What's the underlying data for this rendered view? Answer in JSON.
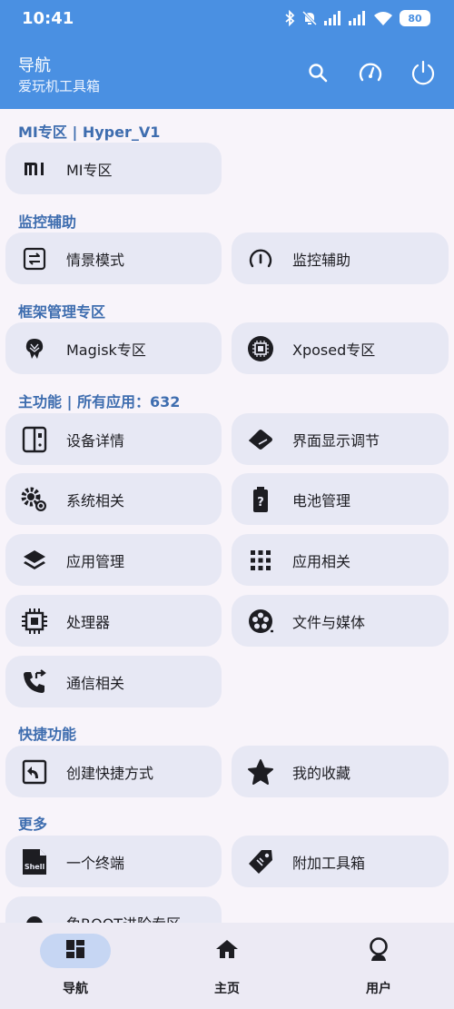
{
  "status_bar": {
    "time": "10:41",
    "battery": "80",
    "icons": [
      "bluetooth-icon",
      "mute-icon",
      "signal-icon",
      "signal-icon",
      "wifi-icon"
    ]
  },
  "app_bar": {
    "title": "导航",
    "subtitle": "爱玩机工具箱",
    "actions": [
      "search-icon",
      "speedometer-icon",
      "power-icon"
    ]
  },
  "sections": {
    "mi": {
      "title": "MI专区 | Hyper_V1",
      "items": [
        {
          "label": "MI专区",
          "icon": "mi-logo-icon"
        }
      ]
    },
    "monitor": {
      "title": "监控辅助",
      "items": [
        {
          "label": "情景模式",
          "icon": "scene-mode-icon"
        },
        {
          "label": "监控辅助",
          "icon": "gauge-icon"
        }
      ]
    },
    "framework": {
      "title": "框架管理专区",
      "items": [
        {
          "label": "Magisk专区",
          "icon": "magisk-icon"
        },
        {
          "label": "Xposed专区",
          "icon": "xposed-chip-icon"
        }
      ]
    },
    "main": {
      "title": "主功能 | 所有应用：632",
      "items": [
        {
          "label": "设备详情",
          "icon": "device-icon"
        },
        {
          "label": "界面显示调节",
          "icon": "display-icon"
        },
        {
          "label": "系统相关",
          "icon": "gears-icon"
        },
        {
          "label": "电池管理",
          "icon": "battery-question-icon"
        },
        {
          "label": "应用管理",
          "icon": "layers-icon"
        },
        {
          "label": "应用相关",
          "icon": "grid-dots-icon"
        },
        {
          "label": "处理器",
          "icon": "processor-icon"
        },
        {
          "label": "文件与媒体",
          "icon": "film-reel-icon"
        },
        {
          "label": "通信相关",
          "icon": "phone-forward-icon"
        }
      ]
    },
    "shortcut": {
      "title": "快捷功能",
      "items": [
        {
          "label": "创建快捷方式",
          "icon": "shortcut-icon"
        },
        {
          "label": "我的收藏",
          "icon": "star-icon"
        }
      ]
    },
    "more": {
      "title": "更多",
      "items": [
        {
          "label": "一个终端",
          "icon": "shell-icon"
        },
        {
          "label": "附加工具箱",
          "icon": "tag-icon"
        },
        {
          "label": "免ROOT进阶专区",
          "icon": "android-icon"
        }
      ]
    }
  },
  "bottom_nav": {
    "items": [
      {
        "label": "导航",
        "icon": "dashboard-icon",
        "active": true
      },
      {
        "label": "主页",
        "icon": "home-icon",
        "active": false
      },
      {
        "label": "用户",
        "icon": "user-icon",
        "active": false
      }
    ]
  },
  "colors": {
    "header": "#4A90E2",
    "section_title": "#3E6DAF",
    "card": "#E7E8F4",
    "background": "#F8F4FA",
    "nav_active_pill": "#C6D6F3"
  }
}
